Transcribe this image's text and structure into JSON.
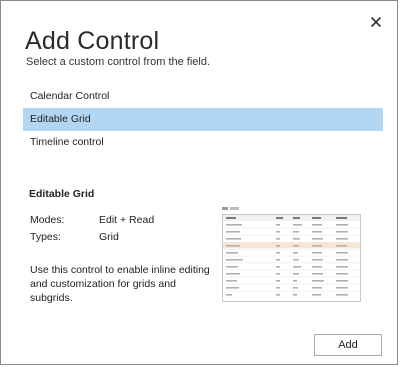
{
  "dialog": {
    "title": "Add Control",
    "subtitle": "Select a custom control from the field.",
    "close_icon": "close-icon"
  },
  "controls": [
    {
      "label": "Calendar Control",
      "selected": false
    },
    {
      "label": "Editable Grid",
      "selected": true
    },
    {
      "label": "Timeline control",
      "selected": false
    }
  ],
  "details": {
    "title": "Editable Grid",
    "modes_label": "Modes:",
    "modes_value": "Edit + Read",
    "types_label": "Types:",
    "types_value": "Grid",
    "description": "Use this control to enable inline editing and customization for grids and subgrids."
  },
  "preview": {
    "image": "editable-grid-thumbnail"
  },
  "footer": {
    "add_label": "Add"
  },
  "colors": {
    "selected_row": "#b3d7f3",
    "highlight_row": "#f7e6d6"
  }
}
